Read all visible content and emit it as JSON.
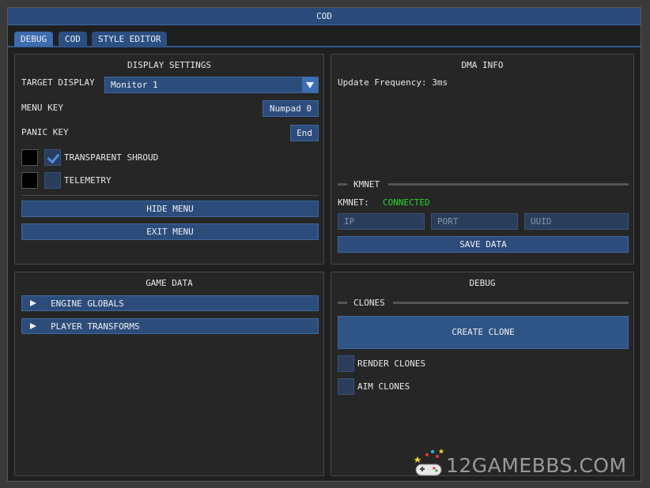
{
  "window": {
    "title": "COD"
  },
  "tabs": [
    {
      "label": "DEBUG",
      "active": true
    },
    {
      "label": "COD",
      "active": false
    },
    {
      "label": "STYLE EDITOR",
      "active": false
    }
  ],
  "display_settings": {
    "title": "DISPLAY SETTINGS",
    "target_display_label": "TARGET DISPLAY",
    "target_display_value": "Monitor 1",
    "menu_key_label": "MENU KEY",
    "menu_key_value": "Numpad 0",
    "panic_key_label": "PANIC KEY",
    "panic_key_value": "End",
    "transparent_shroud_label": "TRANSPARENT SHROUD",
    "transparent_shroud_checked": true,
    "telemetry_label": "TELEMETRY",
    "telemetry_checked": false,
    "hide_menu_label": "HIDE MENU",
    "exit_menu_label": "EXIT MENU"
  },
  "dma_info": {
    "title": "DMA INFO",
    "update_frequency": "Update Frequency: 3ms",
    "kmnet_section": "KMNET",
    "kmnet_label": "KMNET:",
    "kmnet_status": "CONNECTED",
    "ip_placeholder": "IP",
    "port_placeholder": "PORT",
    "uuid_placeholder": "UUID",
    "save_label": "SAVE DATA"
  },
  "game_data": {
    "title": "GAME DATA",
    "items": [
      {
        "label": "ENGINE GLOBALS"
      },
      {
        "label": "PLAYER TRANSFORMS"
      }
    ]
  },
  "debug": {
    "title": "DEBUG",
    "clones_section": "CLONES",
    "create_clone_label": "CREATE CLONE",
    "render_clones_label": "RENDER CLONES",
    "render_clones_checked": false,
    "aim_clones_label": "AIM CLONES",
    "aim_clones_checked": false
  },
  "watermark": {
    "text": "12GAMEBBS.COM"
  },
  "colors": {
    "accent": "#2c4d7c",
    "title_bar": "#294a7a",
    "status_connected": "#2bd92b",
    "panel_bg": "#262626"
  }
}
